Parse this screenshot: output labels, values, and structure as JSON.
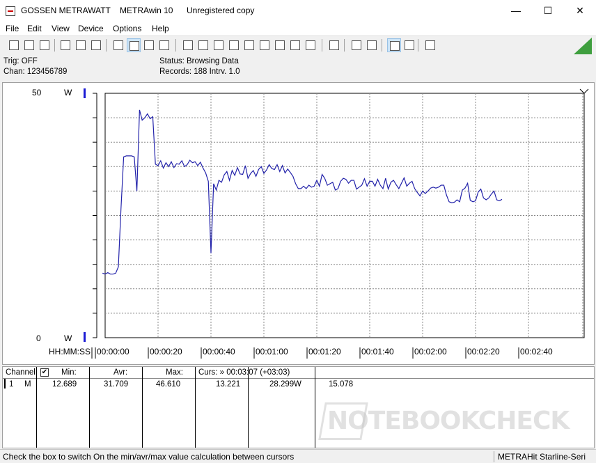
{
  "window": {
    "title_parts": [
      "GOSSEN METRAWATT",
      "METRAwin 10",
      "Unregistered copy"
    ],
    "controls": {
      "minimize": "—",
      "maximize": "☐",
      "close": "✕"
    }
  },
  "menu": [
    "File",
    "Edit",
    "View",
    "Device",
    "Options",
    "Help"
  ],
  "toolbar": {
    "buttons": [
      "open-file",
      "save-file",
      "open-folder",
      "device-read",
      "device-stop",
      "device-step",
      "table-view",
      "graph-view",
      "grid-view",
      "histogram-view",
      "export",
      "copy",
      "list-view",
      "monitor",
      "signal",
      "peak",
      "wave",
      "hold",
      "spec",
      "record",
      "print",
      "print-preview",
      "zoom",
      "search",
      "comment"
    ],
    "active": [
      "graph-view",
      "zoom"
    ]
  },
  "info": {
    "trig": "Trig: OFF",
    "chan": "Chan:  123456789",
    "status": "Status:    Browsing Data",
    "records": "Records: 188  Intrv. 1.0"
  },
  "chart": {
    "y_top_label": "50",
    "y_bottom_label": "0",
    "unit": "W",
    "x_axis_title": "HH:MM:SS",
    "x_ticks": [
      "00:00:00",
      "00:00:20",
      "00:00:40",
      "00:01:00",
      "00:01:20",
      "00:01:40",
      "00:02:00",
      "00:02:20",
      "00:02:40"
    ],
    "line_color": "#2222aa",
    "grid_color": "#888888"
  },
  "chart_data": {
    "type": "line",
    "xlabel": "HH:MM:SS",
    "ylabel": "W",
    "ylim": [
      0,
      50
    ],
    "xlim_seconds": [
      0,
      188
    ],
    "grid": true,
    "series": [
      {
        "values": [
          [
            -1,
            13.2
          ],
          [
            0,
            13.0
          ],
          [
            1,
            13.3
          ],
          [
            2,
            13.0
          ],
          [
            3,
            13.0
          ],
          [
            4,
            13.2
          ],
          [
            5,
            14.5
          ],
          [
            6,
            26.5
          ],
          [
            7,
            37.0
          ],
          [
            8,
            37.2
          ],
          [
            9,
            37.2
          ],
          [
            10,
            37.2
          ],
          [
            11,
            37.0
          ],
          [
            12,
            30.0
          ],
          [
            13,
            46.6
          ],
          [
            14,
            44.5
          ],
          [
            15,
            45.0
          ],
          [
            16,
            45.8
          ],
          [
            17,
            44.8
          ],
          [
            18,
            45.2
          ],
          [
            19,
            35.5
          ],
          [
            20,
            35.2
          ],
          [
            21,
            36.2
          ],
          [
            22,
            34.7
          ],
          [
            23,
            35.8
          ],
          [
            24,
            35.0
          ],
          [
            25,
            36.0
          ],
          [
            26,
            34.8
          ],
          [
            27,
            35.6
          ],
          [
            28,
            35.5
          ],
          [
            29,
            36.2
          ],
          [
            30,
            35.0
          ],
          [
            31,
            35.4
          ],
          [
            32,
            36.3
          ],
          [
            33,
            35.8
          ],
          [
            34,
            36.0
          ],
          [
            35,
            35.2
          ],
          [
            36,
            35.9
          ],
          [
            37,
            34.7
          ],
          [
            38,
            33.7
          ],
          [
            39,
            32.0
          ],
          [
            40,
            17.3
          ],
          [
            41,
            31.5
          ],
          [
            42,
            30.2
          ],
          [
            43,
            32.2
          ],
          [
            44,
            31.8
          ],
          [
            45,
            33.3
          ],
          [
            46,
            34.0
          ],
          [
            47,
            32.2
          ],
          [
            48,
            34.2
          ],
          [
            49,
            33.2
          ],
          [
            50,
            34.8
          ],
          [
            51,
            33.5
          ],
          [
            52,
            33.4
          ],
          [
            53,
            35.2
          ],
          [
            54,
            32.6
          ],
          [
            55,
            33.6
          ],
          [
            56,
            34.2
          ],
          [
            57,
            33.0
          ],
          [
            58,
            34.4
          ],
          [
            59,
            35.0
          ],
          [
            60,
            33.6
          ],
          [
            61,
            34.3
          ],
          [
            62,
            35.4
          ],
          [
            63,
            34.6
          ],
          [
            64,
            34.4
          ],
          [
            65,
            35.4
          ],
          [
            66,
            34.0
          ],
          [
            67,
            35.2
          ],
          [
            68,
            33.7
          ],
          [
            69,
            34.5
          ],
          [
            70,
            33.8
          ],
          [
            71,
            33.0
          ],
          [
            72,
            31.5
          ],
          [
            73,
            30.5
          ],
          [
            74,
            30.5
          ],
          [
            75,
            31.0
          ],
          [
            76,
            30.5
          ],
          [
            77,
            31.2
          ],
          [
            78,
            30.8
          ],
          [
            79,
            31.0
          ],
          [
            80,
            32.2
          ],
          [
            81,
            31.0
          ],
          [
            82,
            33.4
          ],
          [
            83,
            32.6
          ],
          [
            84,
            31.2
          ],
          [
            85,
            31.5
          ],
          [
            86,
            31.8
          ],
          [
            87,
            30.2
          ],
          [
            88,
            30.5
          ],
          [
            89,
            32.0
          ],
          [
            90,
            32.6
          ],
          [
            91,
            32.4
          ],
          [
            92,
            31.6
          ],
          [
            93,
            32.2
          ],
          [
            94,
            32.2
          ],
          [
            95,
            30.4
          ],
          [
            96,
            30.8
          ],
          [
            97,
            31.2
          ],
          [
            98,
            32.5
          ],
          [
            99,
            31.0
          ],
          [
            100,
            32.0
          ],
          [
            101,
            32.0
          ],
          [
            102,
            31.0
          ],
          [
            103,
            32.4
          ],
          [
            104,
            31.2
          ],
          [
            105,
            30.5
          ],
          [
            106,
            32.6
          ],
          [
            107,
            30.4
          ],
          [
            108,
            31.8
          ],
          [
            109,
            32.2
          ],
          [
            110,
            31.3
          ],
          [
            111,
            30.5
          ],
          [
            112,
            31.6
          ],
          [
            113,
            32.7
          ],
          [
            114,
            31.0
          ],
          [
            115,
            31.6
          ],
          [
            116,
            32.0
          ],
          [
            117,
            30.5
          ],
          [
            118,
            29.7
          ],
          [
            119,
            29.0
          ],
          [
            120,
            30.0
          ],
          [
            121,
            29.5
          ],
          [
            122,
            30.0
          ],
          [
            123,
            30.6
          ],
          [
            124,
            30.8
          ],
          [
            125,
            30.6
          ],
          [
            126,
            30.8
          ],
          [
            127,
            31.2
          ],
          [
            128,
            31.2
          ],
          [
            129,
            29.2
          ],
          [
            130,
            27.8
          ],
          [
            131,
            27.6
          ],
          [
            132,
            27.7
          ],
          [
            133,
            28.2
          ],
          [
            134,
            27.8
          ],
          [
            135,
            30.2
          ],
          [
            136,
            30.6
          ],
          [
            137,
            31.6
          ],
          [
            138,
            28.1
          ],
          [
            139,
            27.8
          ],
          [
            140,
            28.0
          ],
          [
            141,
            29.8
          ],
          [
            142,
            30.4
          ],
          [
            143,
            28.6
          ],
          [
            144,
            28.2
          ],
          [
            145,
            28.6
          ],
          [
            146,
            29.4
          ],
          [
            147,
            30.0
          ],
          [
            148,
            28.2
          ],
          [
            149,
            28.0
          ],
          [
            150,
            28.3
          ]
        ]
      }
    ]
  },
  "table": {
    "headers": {
      "channel": "Channel:",
      "min": "Min:",
      "avr": "Avr:",
      "max": "Max:",
      "curs": "Curs: » 00:03:07 (+03:03)"
    },
    "checkbox": "✔",
    "row": {
      "channel_no": "1",
      "channel_type": "M",
      "min": "12.689",
      "avr": "31.709",
      "max": "46.610",
      "cursor_value": "13.221",
      "cursor_avr": "28.299",
      "unit": "W",
      "extra": "15.078"
    }
  },
  "watermark": "NOTEBOOKCHECK",
  "status": {
    "left": "Check the box to switch On the min/avr/max value calculation between cursors",
    "right": "METRAHit Starline-Seri"
  }
}
